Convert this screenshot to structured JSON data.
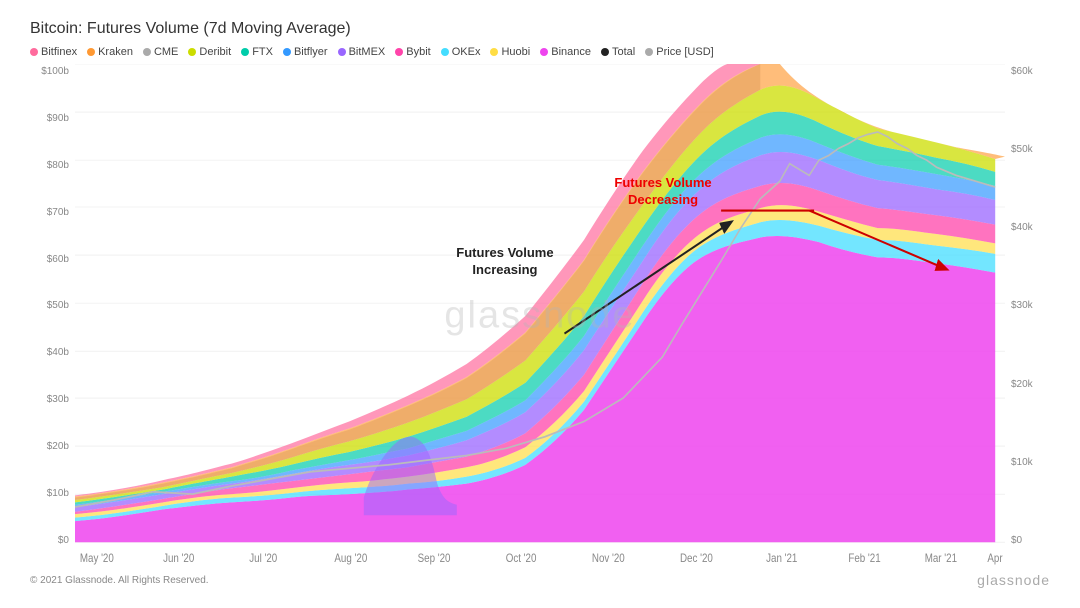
{
  "title": "Bitcoin: Futures Volume (7d Moving Average)",
  "legend": [
    {
      "label": "Bitfinex",
      "color": "#ff6b9d"
    },
    {
      "label": "Kraken",
      "color": "#ff9933"
    },
    {
      "label": "CME",
      "color": "#aaaaaa"
    },
    {
      "label": "Deribit",
      "color": "#ccdd00"
    },
    {
      "label": "FTX",
      "color": "#00ccaa"
    },
    {
      "label": "Bitflyer",
      "color": "#3399ff"
    },
    {
      "label": "BitMEX",
      "color": "#9966ff"
    },
    {
      "label": "Bybit",
      "color": "#ff44aa"
    },
    {
      "label": "OKEx",
      "color": "#44ddff"
    },
    {
      "label": "Huobi",
      "color": "#ffdd44"
    },
    {
      "label": "Binance",
      "color": "#ee44ee"
    },
    {
      "label": "Total",
      "color": "#222222"
    },
    {
      "label": "Price [USD]",
      "color": "#aaaaaa"
    }
  ],
  "yAxisLeft": [
    "$100b",
    "$90b",
    "$80b",
    "$70b",
    "$60b",
    "$50b",
    "$40b",
    "$30b",
    "$20b",
    "$10b",
    "$0"
  ],
  "yAxisRight": [
    "$60k",
    "$50k",
    "$40k",
    "$30k",
    "$20k",
    "$10k",
    "$0"
  ],
  "xAxisLabels": [
    "May '20",
    "Jun '20",
    "Jul '20",
    "Aug '20",
    "Sep '20",
    "Oct '20",
    "Nov '20",
    "Dec '20",
    "Jan '21",
    "Feb '21",
    "Mar '21",
    "Apr '21"
  ],
  "annotations": {
    "decreasing_label": "Futures Volume\nDecreasing",
    "increasing_label": "Futures Volume\nIncreasing"
  },
  "watermark": "glassnode",
  "footer": {
    "copyright": "© 2021 Glassnode. All Rights Reserved.",
    "logo": "glassnode"
  }
}
